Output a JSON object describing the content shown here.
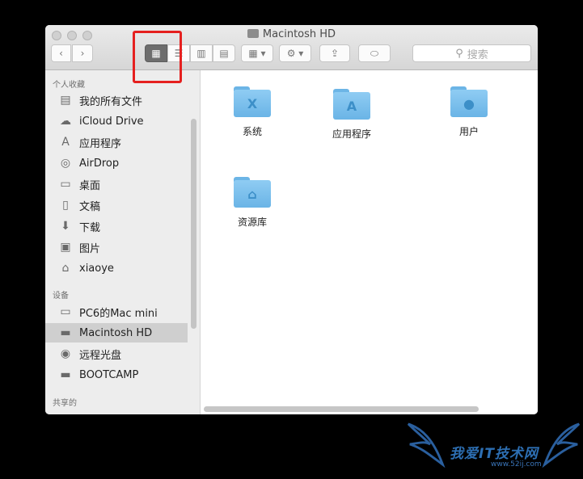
{
  "window": {
    "title": "Macintosh HD"
  },
  "toolbar": {
    "back": "‹",
    "forward": "›",
    "view_icon": "▦",
    "view_list": "☰",
    "view_column": "▥",
    "view_coverflow": "▤",
    "arrange": "▦ ▾",
    "action": "⚙ ▾",
    "share": "⇪",
    "tag": "⬭",
    "search_placeholder": "搜索"
  },
  "sidebar": {
    "favorites_header": "个人收藏",
    "favorites": [
      {
        "label": "我的所有文件",
        "icon": "▤"
      },
      {
        "label": "iCloud Drive",
        "icon": "☁"
      },
      {
        "label": "应用程序",
        "icon": "A"
      },
      {
        "label": "AirDrop",
        "icon": "◎"
      },
      {
        "label": "桌面",
        "icon": "▭"
      },
      {
        "label": "文稿",
        "icon": "▯"
      },
      {
        "label": "下载",
        "icon": "⬇"
      },
      {
        "label": "图片",
        "icon": "▣"
      },
      {
        "label": "xiaoye",
        "icon": "⌂"
      }
    ],
    "devices_header": "设备",
    "devices": [
      {
        "label": "PC6的Mac mini",
        "icon": "▭"
      },
      {
        "label": "Macintosh HD",
        "icon": "▬"
      },
      {
        "label": "远程光盘",
        "icon": "◉"
      },
      {
        "label": "BOOTCAMP",
        "icon": "▬"
      }
    ],
    "shared_header": "共享的"
  },
  "content": {
    "folders": [
      {
        "label": "系统",
        "glyph": "X"
      },
      {
        "label": "应用程序",
        "glyph": "A"
      },
      {
        "label": "用户",
        "glyph": "●"
      },
      {
        "label": "资源库",
        "glyph": "⌂"
      }
    ]
  },
  "watermark": {
    "text": "我爱IT技术网",
    "url": "www.52ij.com"
  },
  "colors": {
    "folder": "#6ab4e6",
    "highlight": "#e5201f",
    "selected_row": "#cfcfcf"
  }
}
